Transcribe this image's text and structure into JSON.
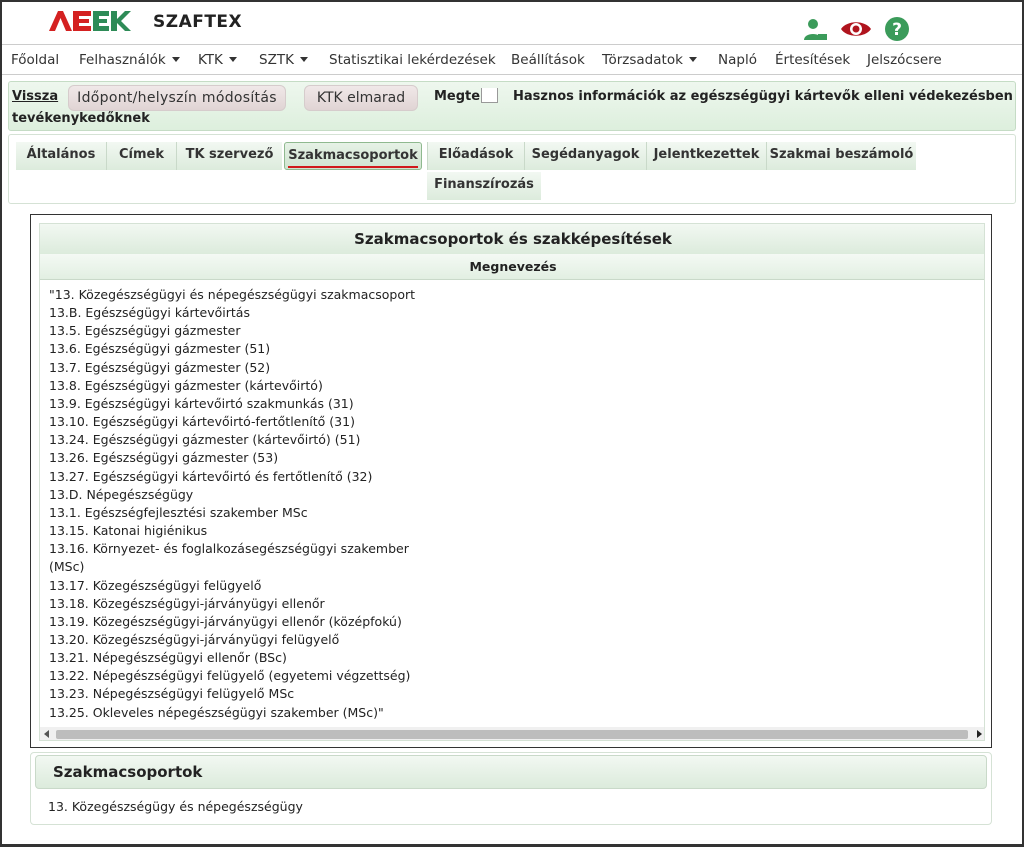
{
  "header": {
    "brand": "SZAFTEX",
    "logo_alt": "AEEK",
    "colors": {
      "logo_red": "#d42121",
      "logo_green": "#2e8b57",
      "icon_green": "#3b9b5a",
      "eye_red": "#b0141e"
    },
    "icons": [
      "user-icon",
      "eye-icon",
      "help-icon"
    ]
  },
  "nav": {
    "items": [
      {
        "label": "Főoldal",
        "dropdown": false
      },
      {
        "label": "Felhasználók",
        "dropdown": true
      },
      {
        "label": "KTK",
        "dropdown": true
      },
      {
        "label": "SZTK",
        "dropdown": true
      },
      {
        "label": "Statisztikai lekérdezések",
        "dropdown": false
      },
      {
        "label": "Beállítások",
        "dropdown": false
      },
      {
        "label": "Törzsadatok",
        "dropdown": true
      },
      {
        "label": "Napló",
        "dropdown": false
      },
      {
        "label": "Értesítések",
        "dropdown": false
      },
      {
        "label": "Jelszócsere",
        "dropdown": false
      }
    ]
  },
  "actionbar": {
    "back": "Vissza",
    "modify": "Időpont/helyszín módosítás",
    "cancel": "KTK elmarad",
    "full_label": "Megtelt",
    "title_line1": "Hasznos információk az egészségügyi kártevők elleni védekezésben",
    "title_line2": "tevékenykedőknek"
  },
  "tabs": [
    {
      "label": "Általános"
    },
    {
      "label": "Címek"
    },
    {
      "label": "TK szervező"
    },
    {
      "label": "Szakmacsoportok",
      "active": true
    },
    {
      "label": "Előadások"
    },
    {
      "label": "Segédanyagok"
    },
    {
      "label": "Jelentkezettek"
    },
    {
      "label": "Szakmai beszámoló"
    },
    {
      "label": "Finanszírozás"
    }
  ],
  "qualifications": {
    "title": "Szakmacsoportok és szakképesítések",
    "column": "Megnevezés",
    "lines": [
      "\"13. Közegészségügyi és népegészségügyi szakmacsoport",
      "13.B. Egészségügyi kártevőirtás",
      "13.5. Egészségügyi gázmester",
      "13.6. Egészségügyi gázmester (51)",
      "13.7. Egészségügyi gázmester (52)",
      "13.8. Egészségügyi gázmester (kártevőirtó)",
      "13.9. Egészségügyi kártevőirtó szakmunkás (31)",
      "13.10. Egészségügyi kártevőirtó-fertőtlenítő (31)",
      "13.24. Egészségügyi gázmester (kártevőirtó) (51)",
      "13.26. Egészségügyi gázmester (53)",
      "13.27. Egészségügyi kártevőirtó és fertőtlenítő (32)",
      "13.D. Népegészségügy",
      "13.1. Egészségfejlesztési szakember MSc",
      "13.15. Katonai higiénikus",
      "13.16. Környezet- és foglalkozásegészségügyi szakember",
      "(MSc)",
      "13.17. Közegészségügyi felügyelő",
      "13.18. Közegészségügyi-járványügyi ellenőr",
      "13.19. Közegészségügyi-járványügyi ellenőr (középfokú)",
      "13.20. Közegészségügyi-járványügyi felügyelő",
      "13.21. Népegészségügyi ellenőr (BSc)",
      "13.22. Népegészségügyi felügyelő (egyetemi végzettség)",
      "13.23. Népegészségügyi felügyelő MSc",
      "13.25. Okleveles népegészségügyi szakember (MSc)\""
    ]
  },
  "groups": {
    "title": "Szakmacsoportok",
    "items": [
      "13. Közegészségügy és népegészségügy"
    ]
  }
}
